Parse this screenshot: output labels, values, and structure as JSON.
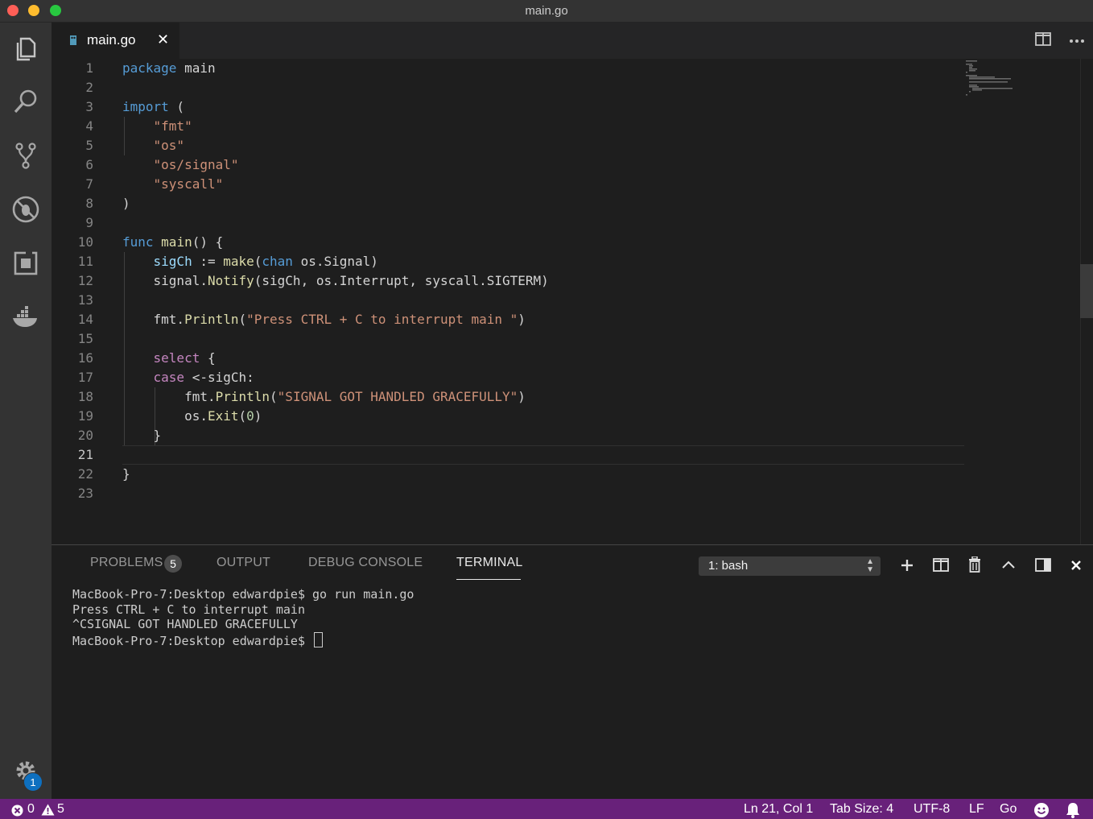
{
  "window": {
    "title": "main.go"
  },
  "tab": {
    "filename": "main.go"
  },
  "editor": {
    "current_line": 21,
    "lines": [
      [
        {
          "t": "package",
          "c": "kw"
        },
        {
          "t": " main"
        }
      ],
      [],
      [
        {
          "t": "import",
          "c": "kw"
        },
        {
          "t": " ("
        }
      ],
      [
        {
          "t": "    "
        },
        {
          "t": "\"fmt\"",
          "c": "str"
        }
      ],
      [
        {
          "t": "    "
        },
        {
          "t": "\"os\"",
          "c": "str"
        }
      ],
      [
        {
          "t": "    "
        },
        {
          "t": "\"os/signal\"",
          "c": "str"
        }
      ],
      [
        {
          "t": "    "
        },
        {
          "t": "\"syscall\"",
          "c": "str"
        }
      ],
      [
        {
          "t": ")"
        }
      ],
      [],
      [
        {
          "t": "func",
          "c": "kw"
        },
        {
          "t": " "
        },
        {
          "t": "main",
          "c": "fn"
        },
        {
          "t": "() {"
        }
      ],
      [
        {
          "t": "    "
        },
        {
          "t": "sigCh",
          "c": "var"
        },
        {
          "t": " := "
        },
        {
          "t": "make",
          "c": "fn"
        },
        {
          "t": "("
        },
        {
          "t": "chan",
          "c": "kw"
        },
        {
          "t": " os.Signal)"
        }
      ],
      [
        {
          "t": "    signal."
        },
        {
          "t": "Notify",
          "c": "fn"
        },
        {
          "t": "(sigCh, os.Interrupt, syscall.SIGTERM)"
        }
      ],
      [],
      [
        {
          "t": "    fmt."
        },
        {
          "t": "Println",
          "c": "fn"
        },
        {
          "t": "("
        },
        {
          "t": "\"Press CTRL + C to interrupt main \"",
          "c": "str"
        },
        {
          "t": ")"
        }
      ],
      [],
      [
        {
          "t": "    "
        },
        {
          "t": "select",
          "c": "kw2"
        },
        {
          "t": " {"
        }
      ],
      [
        {
          "t": "    "
        },
        {
          "t": "case",
          "c": "kw2"
        },
        {
          "t": " <-sigCh:"
        }
      ],
      [
        {
          "t": "        fmt."
        },
        {
          "t": "Println",
          "c": "fn"
        },
        {
          "t": "("
        },
        {
          "t": "\"SIGNAL GOT HANDLED GRACEFULLY\"",
          "c": "str"
        },
        {
          "t": ")"
        }
      ],
      [
        {
          "t": "        os."
        },
        {
          "t": "Exit",
          "c": "fn"
        },
        {
          "t": "("
        },
        {
          "t": "0",
          "c": "num"
        },
        {
          "t": ")"
        }
      ],
      [
        {
          "t": "    }"
        }
      ],
      [],
      [
        {
          "t": "}"
        }
      ],
      []
    ]
  },
  "panel": {
    "tabs": [
      {
        "label": "PROBLEMS",
        "name": "tab-problems"
      },
      {
        "label": "OUTPUT",
        "name": "tab-output"
      },
      {
        "label": "DEBUG CONSOLE",
        "name": "tab-debug-console"
      },
      {
        "label": "TERMINAL",
        "name": "tab-terminal"
      }
    ],
    "problems_count": "5",
    "terminal_select": "1: bash",
    "terminal_lines": [
      "MacBook-Pro-7:Desktop edwardpie$ go run main.go",
      "Press CTRL + C to interrupt main",
      "^CSIGNAL GOT HANDLED GRACEFULLY",
      "MacBook-Pro-7:Desktop edwardpie$ "
    ]
  },
  "activity": {
    "settings_badge": "1"
  },
  "status": {
    "errors": "0",
    "warnings": "5",
    "position": "Ln 21, Col 1",
    "tab_size": "Tab Size: 4",
    "encoding": "UTF-8",
    "eol": "LF",
    "language": "Go"
  }
}
